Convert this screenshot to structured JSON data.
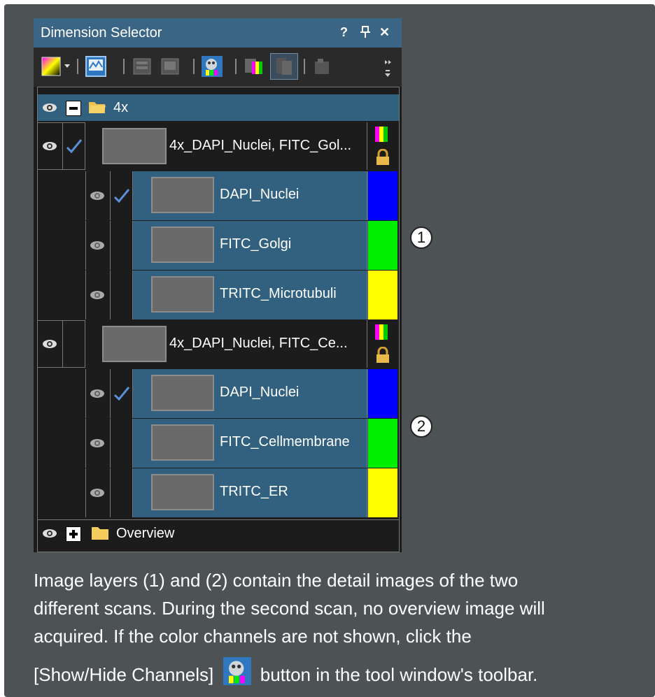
{
  "window": {
    "title": "Dimension Selector",
    "controls": {
      "help": "?",
      "pin": "₽",
      "close": "✕"
    },
    "toolbar_icons": [
      "color-palette-icon",
      "image-view-icon",
      "layers-icon",
      "layers-stack-icon",
      "show-hide-channels-icon",
      "channel-colors-icon",
      "grayscale-icon",
      "export-icon",
      "overflow-icon"
    ]
  },
  "tree": {
    "root_folder": "4x",
    "layer1": {
      "name": "4x_DAPI_Nuclei, FITC_Gol...",
      "channels": [
        {
          "name": "DAPI_Nuclei",
          "color": "#0000ff",
          "checked": true
        },
        {
          "name": "FITC_Golgi",
          "color": "#00ee00",
          "checked": false
        },
        {
          "name": "TRITC_Microtubuli",
          "color": "#ffff00",
          "checked": false
        }
      ]
    },
    "layer2": {
      "name": "4x_DAPI_Nuclei, FITC_Ce...",
      "channels": [
        {
          "name": "DAPI_Nuclei",
          "color": "#0000ff",
          "checked": true
        },
        {
          "name": "FITC_Cellmembrane",
          "color": "#00ee00",
          "checked": false
        },
        {
          "name": "TRITC_ER",
          "color": "#ffff00",
          "checked": false
        }
      ]
    },
    "overview_folder": "Overview"
  },
  "callouts": {
    "one": "1",
    "two": "2"
  },
  "caption": {
    "line1": "Image layers (1) and (2) contain the detail images of the two",
    "line2": "different scans. During the second scan, no overview image will",
    "line3": "acquired. If the color channels are not shown, click the",
    "line4a": "[Show/Hide Channels]",
    "line4b": "button in the tool window's toolbar."
  },
  "colors": {
    "titlebar": "#3b6584",
    "selected_row": "#31617f",
    "dark_row": "#1c1c1c",
    "page_background": "#4d5255"
  }
}
